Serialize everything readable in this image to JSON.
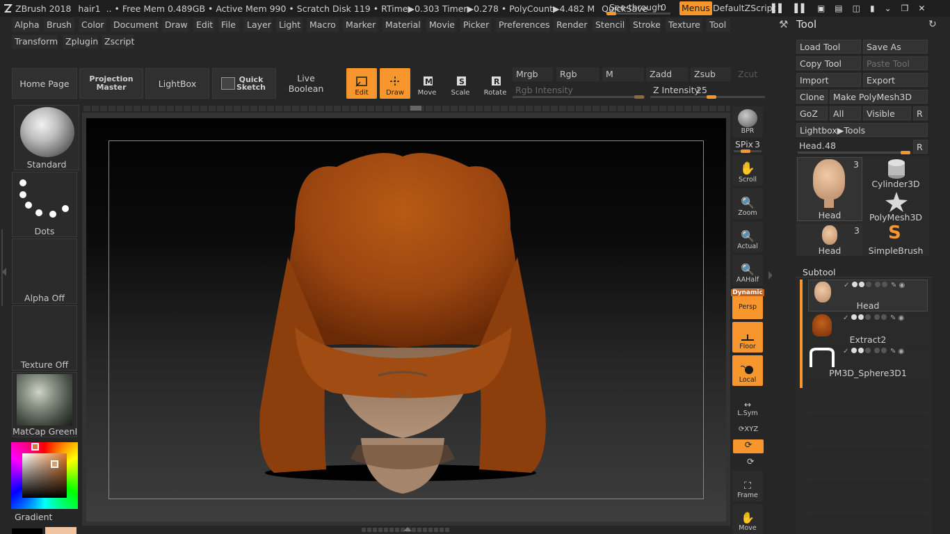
{
  "titlebar": {
    "app": "ZBrush 2018",
    "doc": "hair1",
    "free_mem": ".. • Free Mem 0.489GB • Active Mem 990 • Scratch Disk 119 •",
    "rtime": "RTime▶0.303 Timer▶0.278 • PolyCount▶4.482 M",
    "quicksave": "QuickSave",
    "see_through_label": "See-through",
    "see_through_value": "0",
    "menus": "Menus",
    "script": "DefaultZScript"
  },
  "menus": [
    "Alpha",
    "Brush",
    "Color",
    "Document",
    "Draw",
    "Edit",
    "File",
    "Layer",
    "Light",
    "Macro",
    "Marker",
    "Material",
    "Movie",
    "Picker",
    "Preferences",
    "Render",
    "Stencil",
    "Stroke",
    "Texture",
    "Tool"
  ],
  "menus_row2": [
    "Transform",
    "Zplugin",
    "Zscript"
  ],
  "shelf": {
    "home_page": "Home Page",
    "projection_master_1": "Projection",
    "projection_master_2": "Master",
    "lightbox": "LightBox",
    "quick_sketch_1": "Quick",
    "quick_sketch_2": "Sketch",
    "live_boolean": "Live Boolean",
    "edit": "Edit",
    "draw": "Draw",
    "move": "Move",
    "scale": "Scale",
    "rotate": "Rotate",
    "mrgb": "Mrgb",
    "rgb": "Rgb",
    "m": "M",
    "zadd": "Zadd",
    "zsub": "Zsub",
    "zcut": "Zcut",
    "rgb_intensity": "Rgb Intensity",
    "z_intensity_label": "Z Intensity",
    "z_intensity_value": "25"
  },
  "left": {
    "brush": "Standard",
    "stroke": "Dots",
    "alpha": "Alpha Off",
    "texture": "Texture Off",
    "material": "MatCap GreenRc",
    "gradient": "Gradient"
  },
  "right": {
    "bpr": "BPR",
    "spix_label": "SPix",
    "spix_value": "3",
    "scroll": "Scroll",
    "zoom": "Zoom",
    "actual": "Actual",
    "aahalf": "AAHalf",
    "dynamic": "Dynamic",
    "persp": "Persp",
    "floor": "Floor",
    "local": "Local",
    "lsym": "L.Sym",
    "xyz": "XYZ",
    "frame": "Frame",
    "move": "Move"
  },
  "tool": {
    "title": "Tool",
    "load_tool": "Load Tool",
    "save_as": "Save As",
    "copy_tool": "Copy Tool",
    "paste_tool": "Paste Tool",
    "import": "Import",
    "export": "Export",
    "clone": "Clone",
    "make_polymesh": "Make PolyMesh3D",
    "goz": "GoZ",
    "all": "All",
    "visible": "Visible",
    "r": "R",
    "lightbox_tools": "Lightbox▶Tools",
    "head_label": "Head.",
    "head_value": "48",
    "thumbs": [
      {
        "name": "Head",
        "count": "3"
      },
      {
        "name": "Cylinder3D",
        "count": ""
      },
      {
        "name": "PolyMesh3D",
        "count": ""
      },
      {
        "name": "Head",
        "count": "3"
      },
      {
        "name": "SimpleBrush",
        "count": ""
      }
    ],
    "subtool_title": "Subtool",
    "subtools": [
      "Head",
      "Extract2",
      "PM3D_Sphere3D1"
    ]
  },
  "colors": {
    "accent": "#f7962c",
    "panel": "#262626",
    "hair": "#a44a10",
    "skin": "#a8866a"
  }
}
